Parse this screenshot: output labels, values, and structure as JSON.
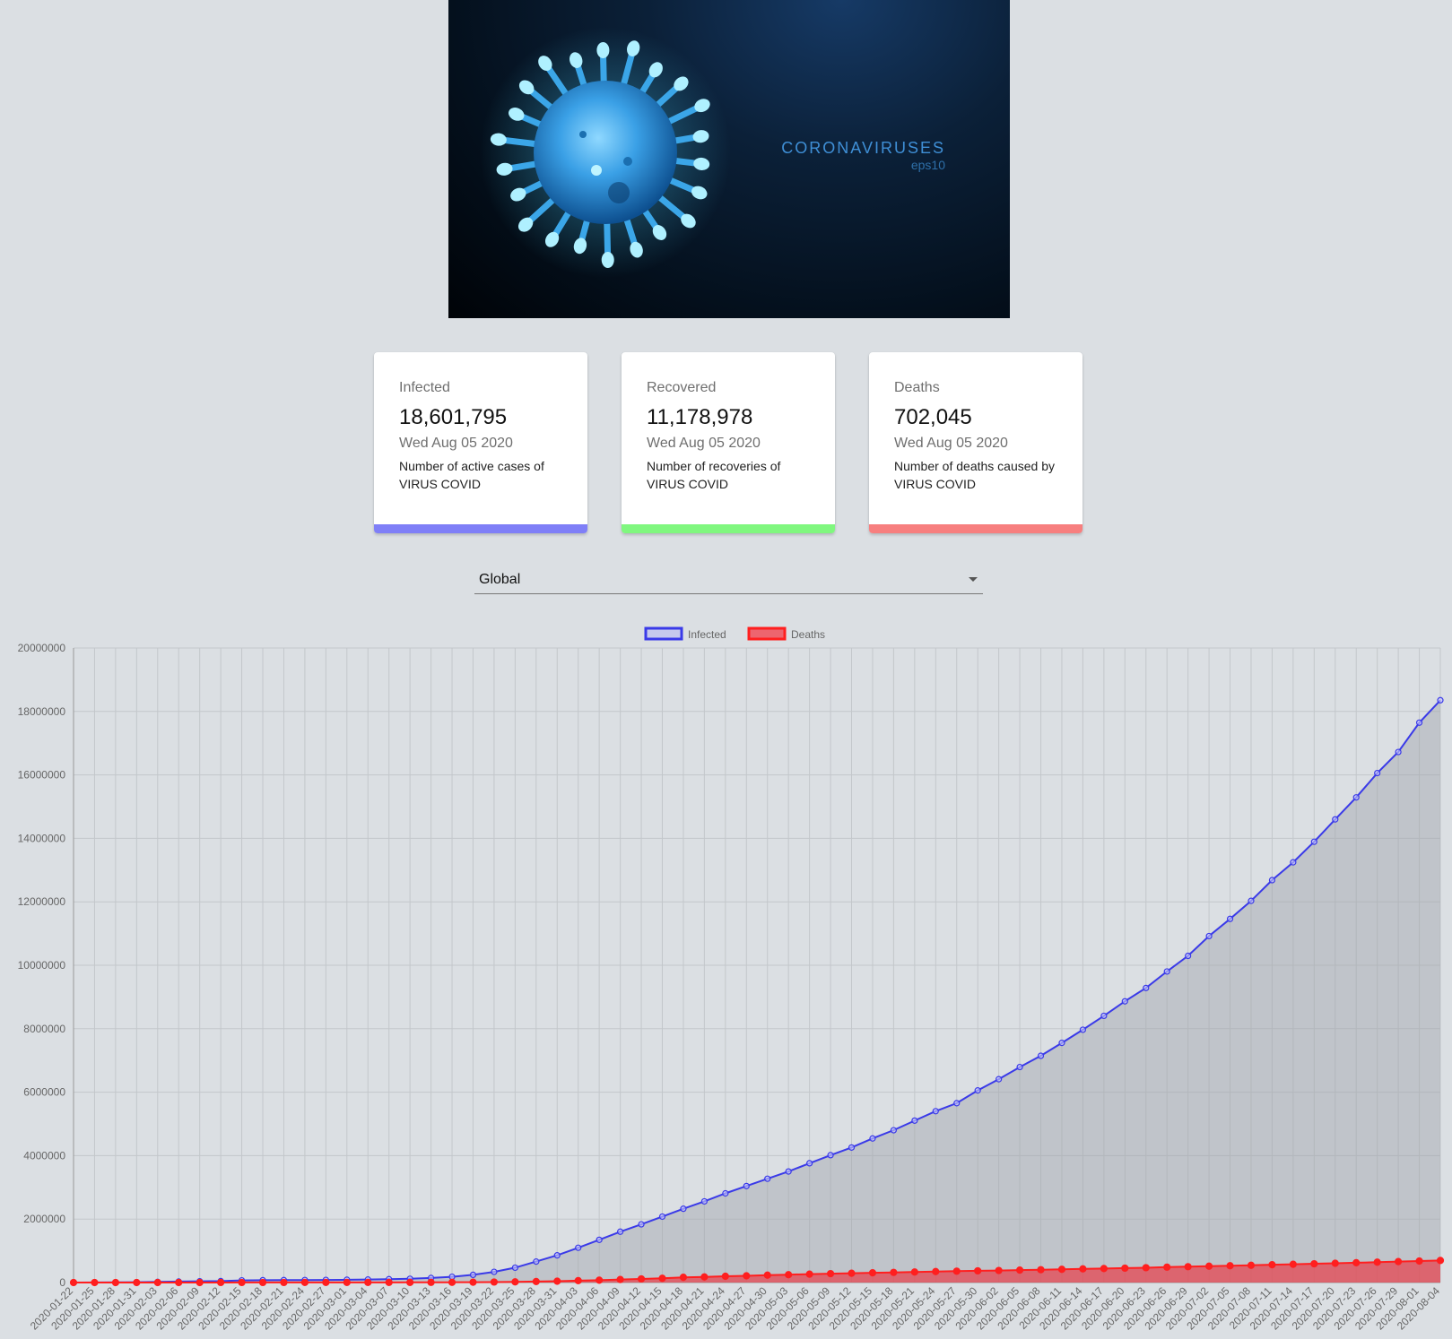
{
  "banner": {
    "title": "CORONAVIRUSES",
    "subtitle": "eps10"
  },
  "cards": [
    {
      "title": "Infected",
      "value": "18,601,795",
      "date": "Wed Aug 05 2020",
      "description": "Number of active cases of VIRUS COVID",
      "color": "#7f7ff7"
    },
    {
      "title": "Recovered",
      "value": "11,178,978",
      "date": "Wed Aug 05 2020",
      "description": "Number of recoveries of VIRUS COVID",
      "color": "#80f77f"
    },
    {
      "title": "Deaths",
      "value": "702,045",
      "date": "Wed Aug 05 2020",
      "description": "Number of deaths caused by VIRUS COVID",
      "color": "#f77f7f"
    }
  ],
  "country_select": {
    "value": "Global"
  },
  "chart_data": {
    "type": "line",
    "start_date": "2020-01-22",
    "end_date": "2020-08-04",
    "x": [
      "2020-01-22",
      "2020-01-25",
      "2020-01-28",
      "2020-01-31",
      "2020-02-03",
      "2020-02-06",
      "2020-02-09",
      "2020-02-12",
      "2020-02-15",
      "2020-02-18",
      "2020-02-21",
      "2020-02-24",
      "2020-02-27",
      "2020-03-01",
      "2020-03-04",
      "2020-03-07",
      "2020-03-10",
      "2020-03-13",
      "2020-03-16",
      "2020-03-19",
      "2020-03-22",
      "2020-03-25",
      "2020-03-28",
      "2020-03-31",
      "2020-04-03",
      "2020-04-06",
      "2020-04-09",
      "2020-04-12",
      "2020-04-15",
      "2020-04-18",
      "2020-04-21",
      "2020-04-24",
      "2020-04-27",
      "2020-04-30",
      "2020-05-03",
      "2020-05-06",
      "2020-05-09",
      "2020-05-12",
      "2020-05-15",
      "2020-05-18",
      "2020-05-21",
      "2020-05-24",
      "2020-05-27",
      "2020-05-30",
      "2020-06-02",
      "2020-06-05",
      "2020-06-08",
      "2020-06-11",
      "2020-06-14",
      "2020-06-17",
      "2020-06-20",
      "2020-06-23",
      "2020-06-26",
      "2020-06-29",
      "2020-07-02",
      "2020-07-05",
      "2020-07-08",
      "2020-07-11",
      "2020-07-14",
      "2020-07-17",
      "2020-07-20",
      "2020-07-23",
      "2020-07-26",
      "2020-07-29",
      "2020-08-01",
      "2020-08-04"
    ],
    "series": [
      {
        "name": "Infected",
        "color": "#3a3ae8",
        "values": [
          555,
          2927,
          5578,
          9927,
          20700,
          30818,
          40553,
          45221,
          68770,
          73332,
          76823,
          79356,
          83112,
          88369,
          95124,
          105836,
          118582,
          145193,
          181546,
          242708,
          336953,
          467653,
          660693,
          857487,
          1095917,
          1346299,
          1602163,
          1834613,
          2078605,
          2326054,
          2558000,
          2811000,
          3041000,
          3272000,
          3500000,
          3760000,
          4014000,
          4256000,
          4541000,
          4801000,
          5103000,
          5401000,
          5653000,
          6056000,
          6409000,
          6792000,
          7146000,
          7553000,
          7968000,
          8406000,
          8864000,
          9284000,
          9804000,
          10296000,
          10920000,
          11461000,
          12030000,
          12683000,
          13245000,
          13893000,
          14598000,
          15291000,
          16057000,
          16722000,
          17647000,
          18354000
        ]
      },
      {
        "name": "Deaths",
        "color": "#ff1f1f",
        "values": [
          17,
          42,
          133,
          259,
          427,
          565,
          906,
          1370,
          1666,
          2006,
          2251,
          2704,
          2858,
          3085,
          3348,
          3584,
          4262,
          5825,
          7926,
          10835,
          15431,
          22117,
          30998,
          42364,
          59184,
          74566,
          95635,
          114094,
          133460,
          164938,
          177520,
          197176,
          211558,
          233430,
          248144,
          264679,
          280296,
          292997,
          307396,
          320073,
          331921,
          345141,
          358049,
          368807,
          379883,
          392134,
          404062,
          416051,
          430282,
          441845,
          453874,
          467305,
          486095,
          500103,
          514512,
          530106,
          544563,
          561001,
          575924,
          591876,
          608223,
          624876,
          641785,
          660144,
          678910,
          694815
        ]
      }
    ],
    "y_ticks": [
      0,
      2000000,
      4000000,
      6000000,
      8000000,
      10000000,
      12000000,
      14000000,
      16000000,
      18000000,
      20000000
    ],
    "ylim": [
      0,
      20000000
    ],
    "legend": [
      "Infected",
      "Deaths"
    ],
    "legend_position": "top",
    "grid": true
  }
}
